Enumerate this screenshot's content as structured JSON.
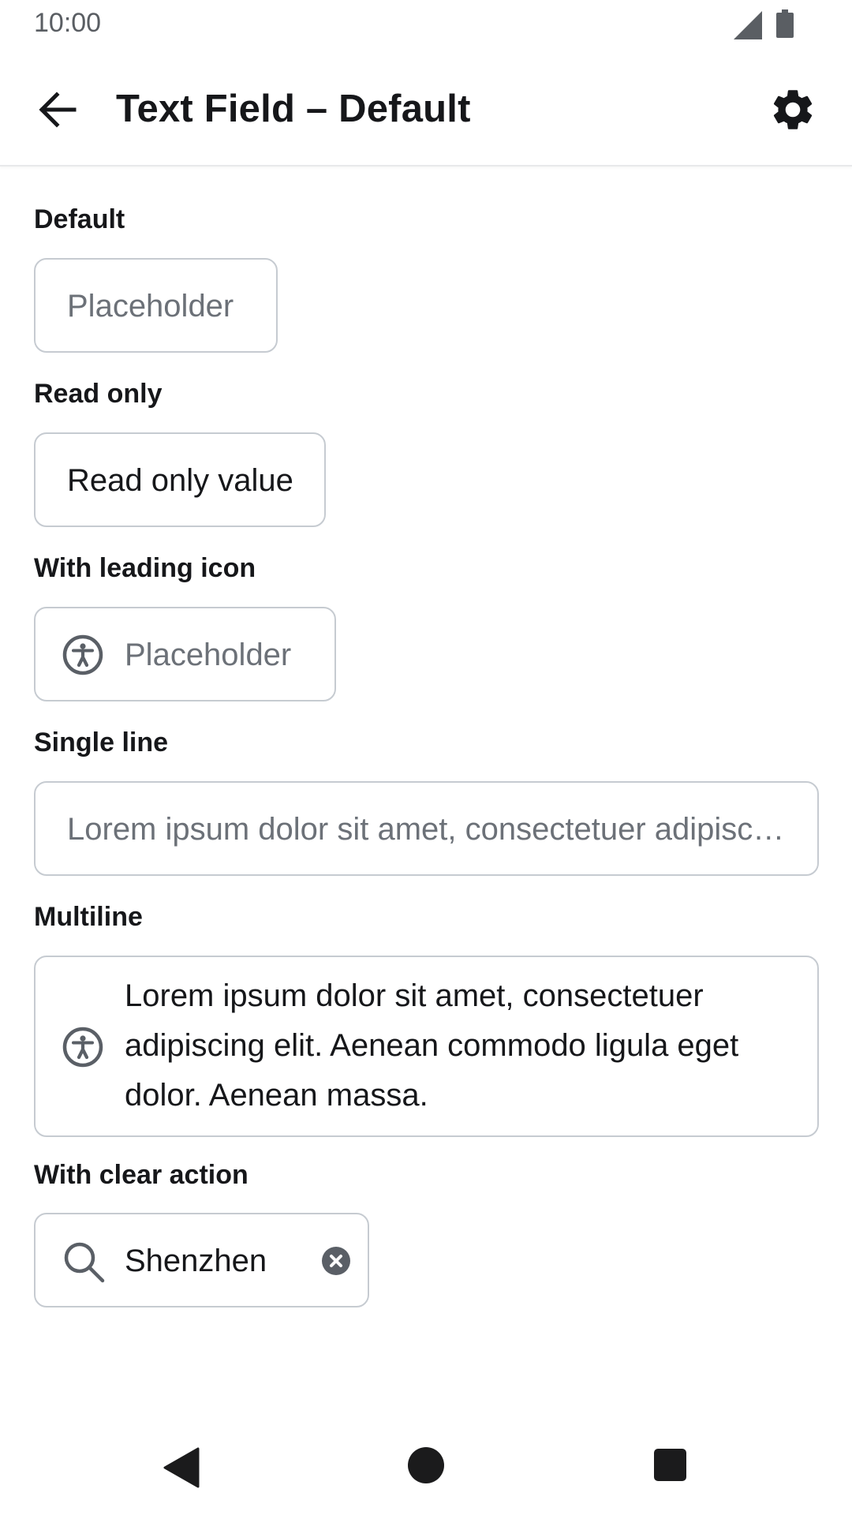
{
  "status_bar": {
    "time": "10:00"
  },
  "app_bar": {
    "title": "Text Field – Default"
  },
  "sections": {
    "default": {
      "label": "Default",
      "placeholder": "Placeholder"
    },
    "read_only": {
      "label": "Read only",
      "value": "Read only value"
    },
    "leading_icon": {
      "label": "With leading icon",
      "placeholder": "Placeholder",
      "icon": "accessibility-icon"
    },
    "single_line": {
      "label": "Single line",
      "placeholder": "Lorem ipsum dolor sit amet, consectetuer adipiscing elit. Aenean commodo ligula eget dolor."
    },
    "multiline": {
      "label": "Multiline",
      "value": "Lorem ipsum dolor sit amet, consectetuer adipiscing elit. Aenean commodo ligula eget dolor. Aenean massa.",
      "icon": "accessibility-icon"
    },
    "clear_action": {
      "label": "With clear action",
      "value": "Shenzhen",
      "leading_icon": "search-icon",
      "trailing_icon": "clear-icon"
    }
  },
  "colors": {
    "text": "#16171a",
    "placeholder": "#6c7178",
    "border": "#c6cbd1",
    "icon": "#5a5f66"
  }
}
